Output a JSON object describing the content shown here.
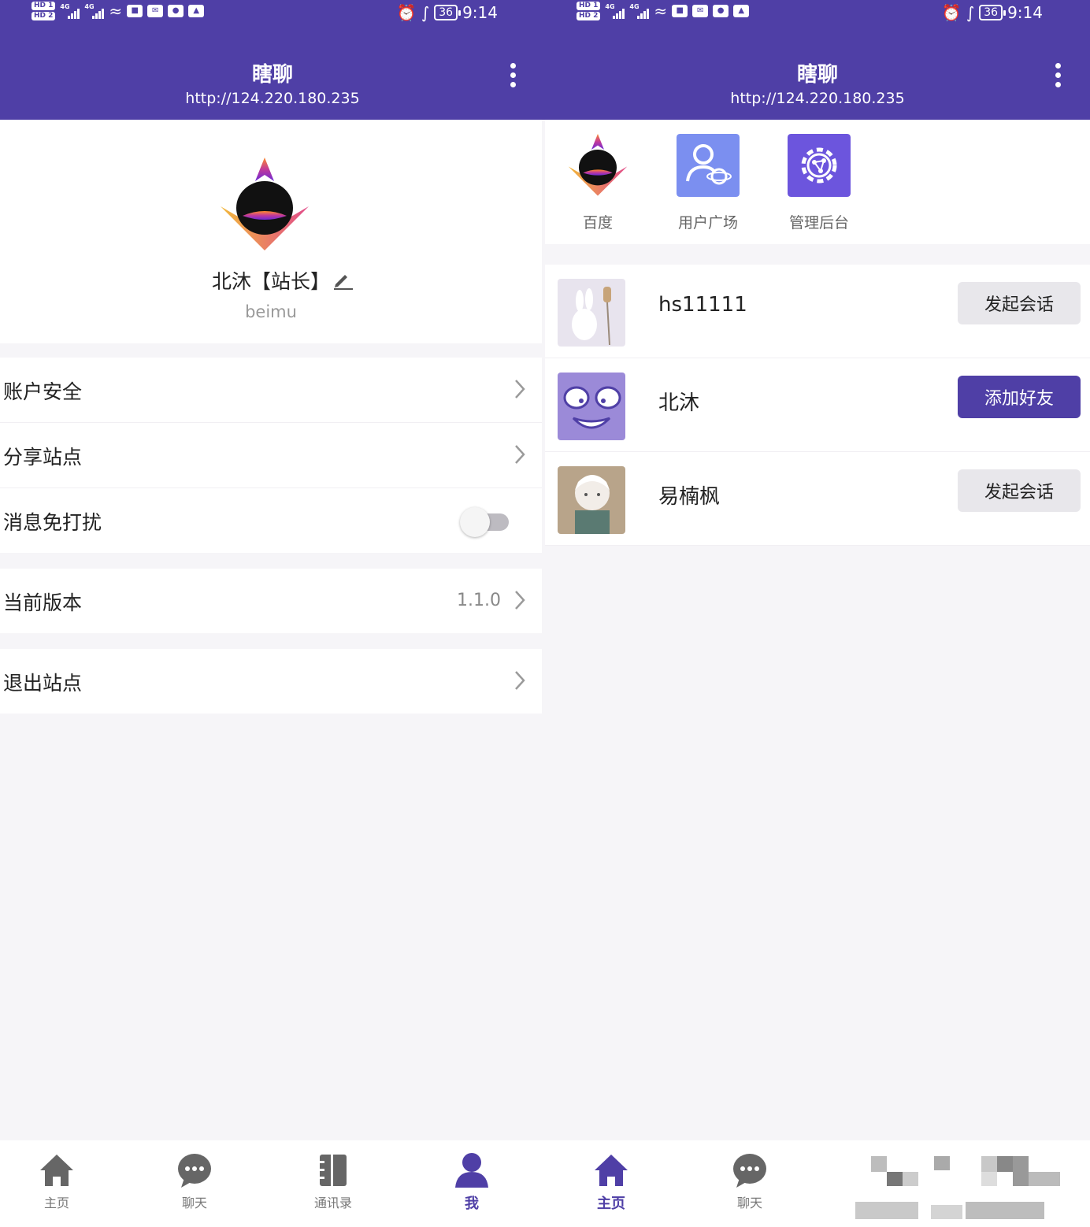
{
  "status_bar": {
    "time": "9:14",
    "battery": "36",
    "signal": "4G"
  },
  "app": {
    "title": "瞎聊",
    "server": "http://124.220.180.235"
  },
  "profile": {
    "display_name": "北沐【站长】",
    "username": "beimu"
  },
  "menu": {
    "account_security": "账户安全",
    "share_site": "分享站点",
    "do_not_disturb": "消息免打扰",
    "do_not_disturb_on": false,
    "current_version": "当前版本",
    "version_value": "1.1.0",
    "logout_site": "退出站点"
  },
  "quick_links": [
    {
      "label": "百度",
      "icon": "site-logo-icon"
    },
    {
      "label": "用户广场",
      "icon": "user-plaza-icon",
      "color": "#7b8ff0"
    },
    {
      "label": "管理后台",
      "icon": "admin-gear-icon",
      "color": "#6c55dd"
    }
  ],
  "contacts": [
    {
      "name": "hs11111",
      "action": "发起会话",
      "style": "gray"
    },
    {
      "name": "北沐",
      "action": "添加好友",
      "style": "purple"
    },
    {
      "name": "易楠枫",
      "action": "发起会话",
      "style": "gray"
    }
  ],
  "nav": {
    "home": "主页",
    "chat": "聊天",
    "contacts": "通讯录",
    "me": "我"
  },
  "colors": {
    "primary": "#4f3fa6",
    "background": "#f6f5f8",
    "text": "#222222"
  }
}
